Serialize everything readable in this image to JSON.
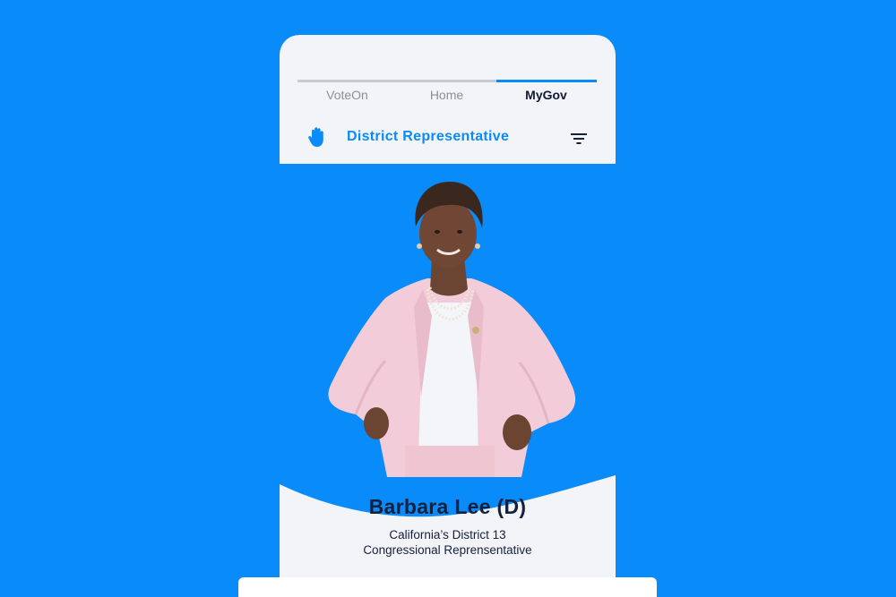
{
  "tabs": [
    {
      "label": "VoteOn",
      "active": false
    },
    {
      "label": "Home",
      "active": false
    },
    {
      "label": "MyGov",
      "active": true
    }
  ],
  "header": {
    "section_title": "District Representative",
    "left_icon": "hand-icon",
    "right_icon": "filter-icon"
  },
  "representative": {
    "name": "Barbara Lee (D)",
    "line1": "California’s District 13",
    "line2": "Congressional Reprensentative"
  },
  "colors": {
    "accent": "#0A8BFA",
    "header_bg": "#F2F4F7",
    "text_dark": "#15203B",
    "tab_inactive": "#8A9099"
  }
}
